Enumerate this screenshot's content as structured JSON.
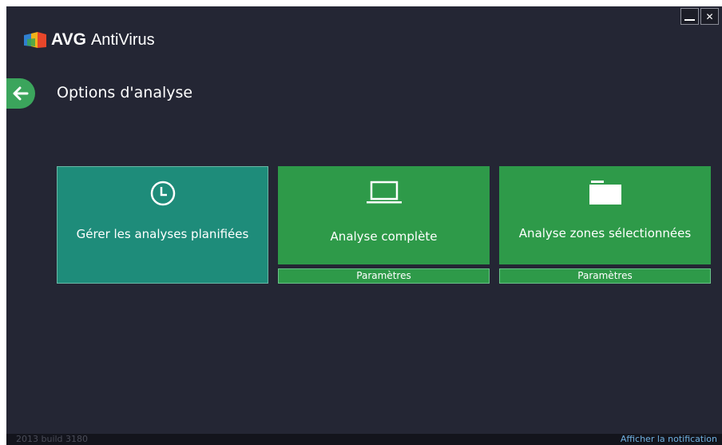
{
  "window": {
    "minimize_label": "_",
    "close_label": "✕"
  },
  "header": {
    "brand": "AVG",
    "product": "AntiVirus"
  },
  "page": {
    "title": "Options d'analyse"
  },
  "tiles": [
    {
      "label": "Gérer les analyses planifiées",
      "icon": "clock-icon"
    },
    {
      "label": "Analyse complète",
      "icon": "laptop-icon",
      "params_label": "Paramètres"
    },
    {
      "label": "Analyse zones sélectionnées",
      "icon": "folder-icon",
      "params_label": "Paramètres"
    }
  ],
  "footer": {
    "build": "2013  build 3180",
    "notification_link": "Afficher la notification"
  },
  "colors": {
    "background": "#242634",
    "tile_teal": "#1e8c7a",
    "tile_green": "#2e9a49",
    "back_button": "#3ba55c"
  }
}
